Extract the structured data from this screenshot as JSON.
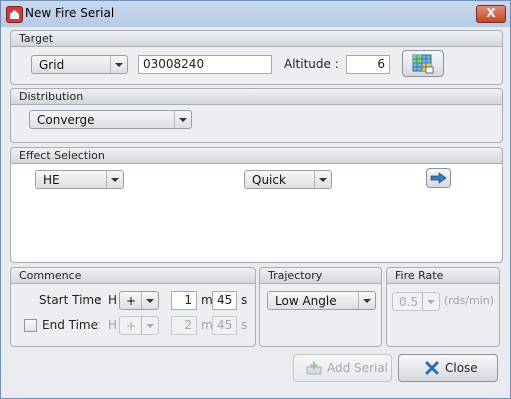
{
  "window": {
    "title": "New Fire Serial",
    "close_glyph": "X"
  },
  "target": {
    "header": "Target",
    "type_value": "Grid",
    "grid_value": "03008240",
    "altitude_label": "Altitude :",
    "altitude_value": "6",
    "map_button_icon": "grid-map-icon"
  },
  "distribution": {
    "header": "Distribution",
    "value": "Converge"
  },
  "effect": {
    "header": "Effect Selection",
    "munition_value": "HE",
    "fuze_value": "Quick",
    "add_icon": "arrow-right-icon"
  },
  "commence": {
    "header": "Commence",
    "start_label": "Start Time",
    "start_colon": ":",
    "h_label": "H",
    "start_sign": "+",
    "start_minutes": "1",
    "m_label": "m",
    "start_seconds": "45",
    "s_label": "s",
    "end_label": "End Time",
    "end_colon": ":",
    "end_h_label": "H",
    "end_sign": "+",
    "end_minutes": "2",
    "end_m_label": "m",
    "end_seconds": "45",
    "end_s_label": "s"
  },
  "trajectory": {
    "header": "Trajectory",
    "value": "Low Angle"
  },
  "fire_rate": {
    "header": "Fire Rate",
    "value": "0.5",
    "unit": "(rds/min)"
  },
  "footer": {
    "add_serial_label": "Add Serial",
    "close_label": "Close"
  }
}
